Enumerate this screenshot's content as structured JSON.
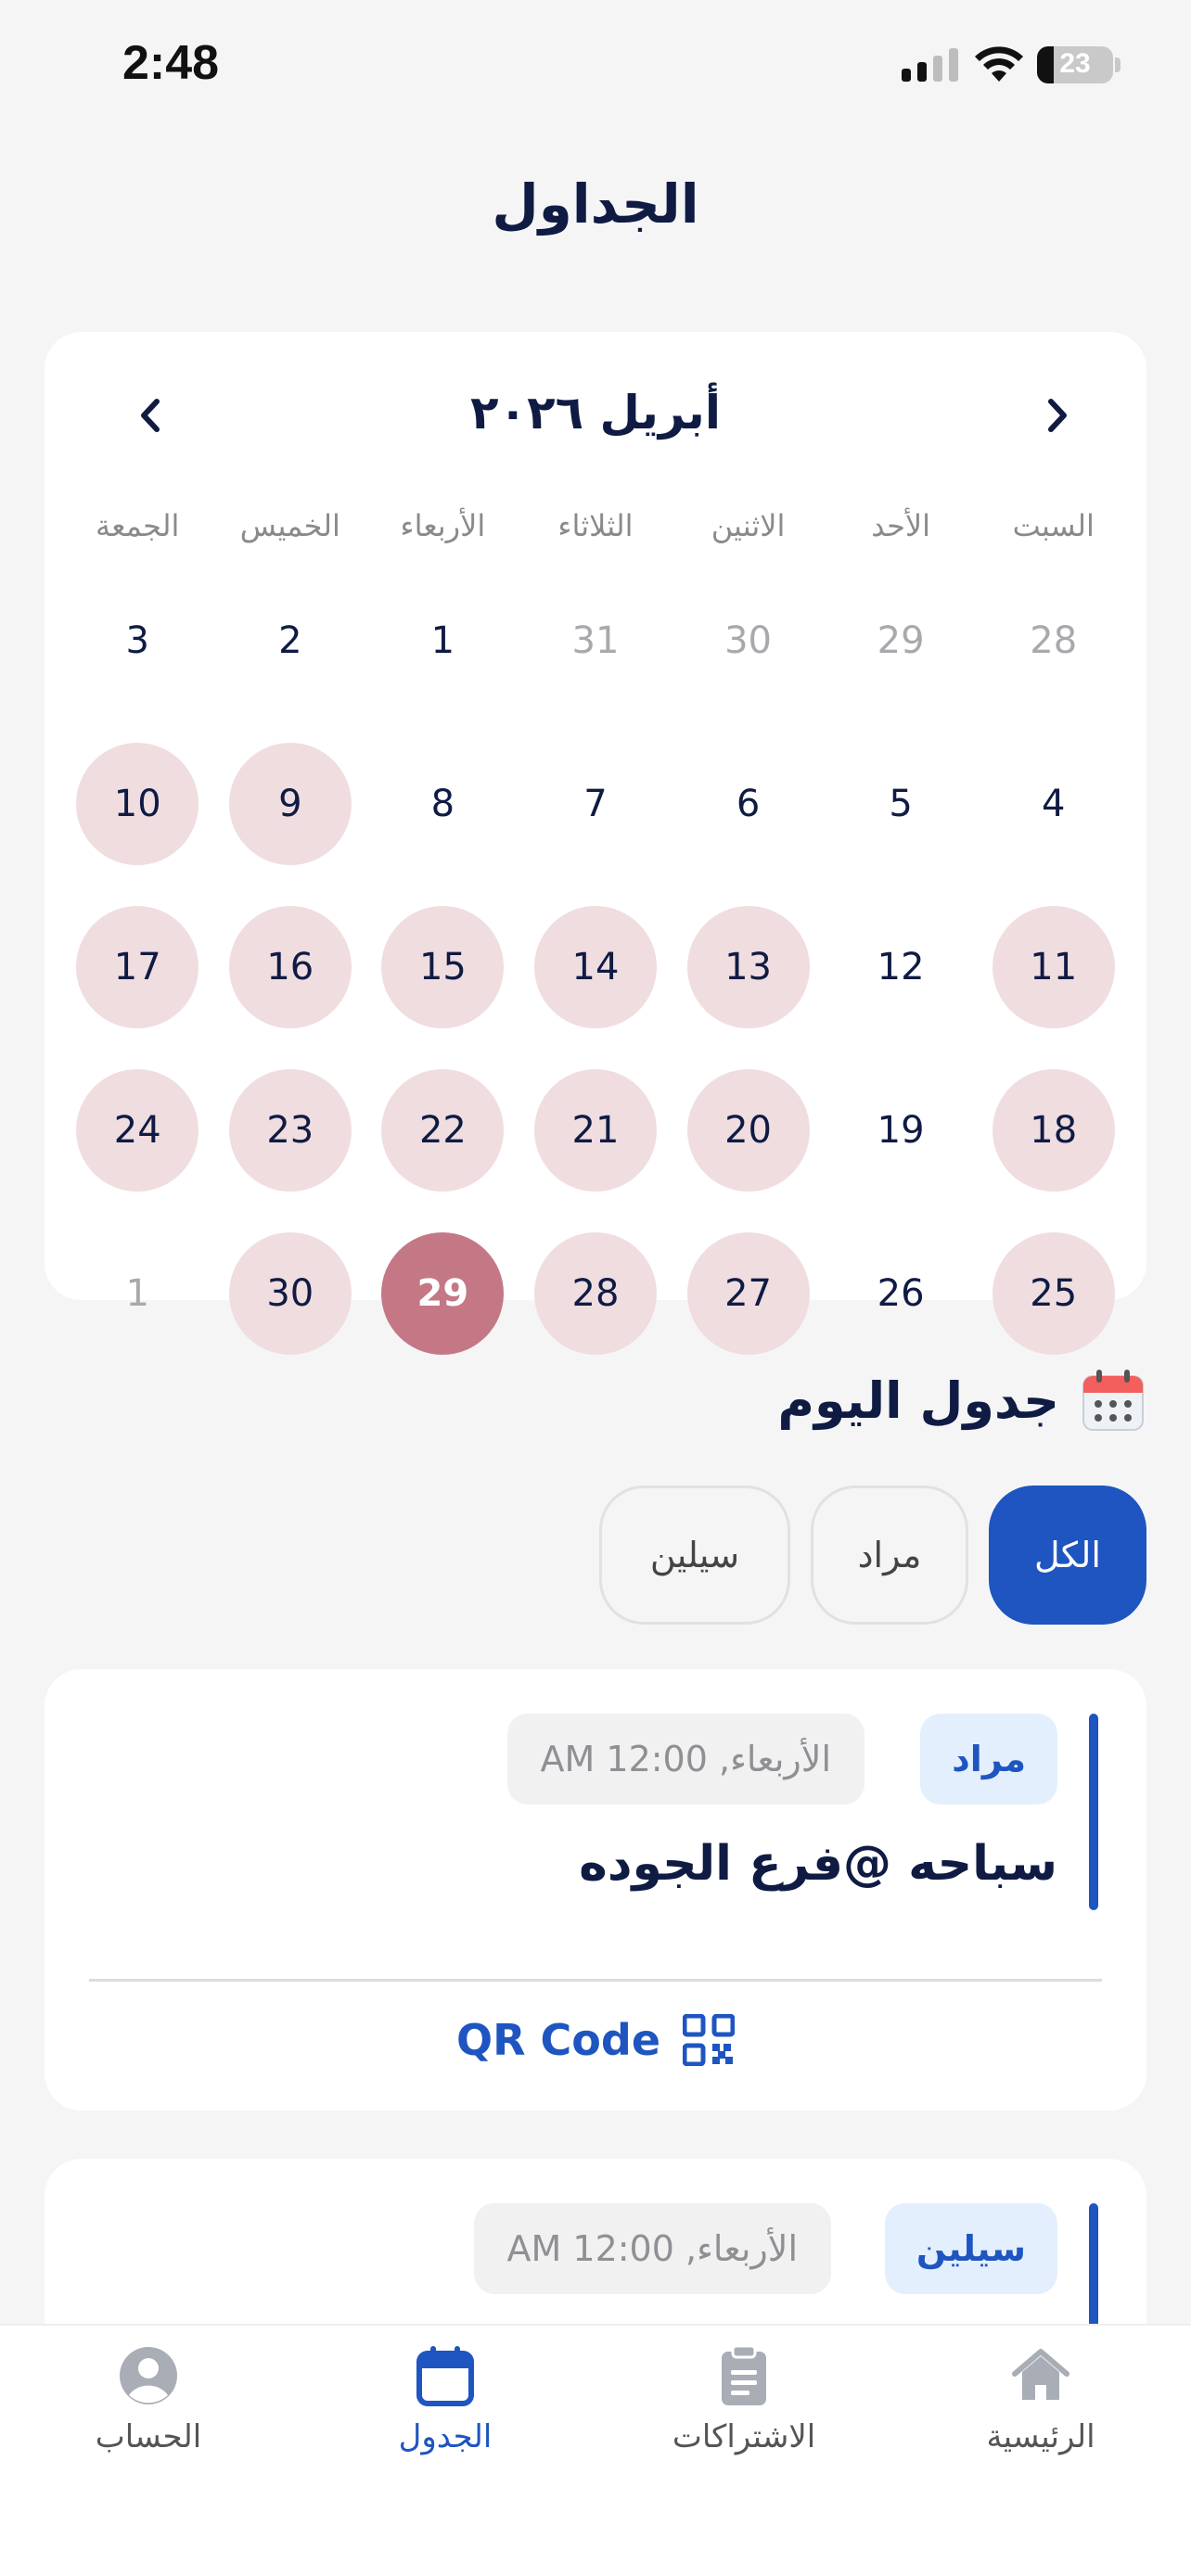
{
  "status_bar": {
    "time": "2:48",
    "battery": "23"
  },
  "header": {
    "title": "الجداول"
  },
  "calendar": {
    "month_label": "أبريل ٢٠٢٦",
    "weekdays": [
      "السبت",
      "الأحد",
      "الاثنين",
      "الثلاثاء",
      "الأربعاء",
      "الخميس",
      "الجمعة"
    ],
    "weeks": [
      [
        {
          "d": "28",
          "s": "muted"
        },
        {
          "d": "29",
          "s": "muted"
        },
        {
          "d": "30",
          "s": "muted"
        },
        {
          "d": "31",
          "s": "muted"
        },
        {
          "d": "1",
          "s": "normal"
        },
        {
          "d": "2",
          "s": "normal"
        },
        {
          "d": "3",
          "s": "normal"
        }
      ],
      [
        {
          "d": "4",
          "s": "normal"
        },
        {
          "d": "5",
          "s": "normal"
        },
        {
          "d": "6",
          "s": "normal"
        },
        {
          "d": "7",
          "s": "normal"
        },
        {
          "d": "8",
          "s": "normal"
        },
        {
          "d": "9",
          "s": "booked"
        },
        {
          "d": "10",
          "s": "booked"
        }
      ],
      [
        {
          "d": "11",
          "s": "booked"
        },
        {
          "d": "12",
          "s": "normal"
        },
        {
          "d": "13",
          "s": "booked"
        },
        {
          "d": "14",
          "s": "booked"
        },
        {
          "d": "15",
          "s": "booked"
        },
        {
          "d": "16",
          "s": "booked"
        },
        {
          "d": "17",
          "s": "booked"
        }
      ],
      [
        {
          "d": "18",
          "s": "booked"
        },
        {
          "d": "19",
          "s": "normal"
        },
        {
          "d": "20",
          "s": "booked"
        },
        {
          "d": "21",
          "s": "booked"
        },
        {
          "d": "22",
          "s": "booked"
        },
        {
          "d": "23",
          "s": "booked"
        },
        {
          "d": "24",
          "s": "booked"
        }
      ],
      [
        {
          "d": "25",
          "s": "booked"
        },
        {
          "d": "26",
          "s": "normal"
        },
        {
          "d": "27",
          "s": "booked"
        },
        {
          "d": "28",
          "s": "booked"
        },
        {
          "d": "29",
          "s": "selected"
        },
        {
          "d": "30",
          "s": "booked"
        },
        {
          "d": "1",
          "s": "muted"
        }
      ]
    ]
  },
  "today": {
    "title": "جدول اليوم"
  },
  "filters": [
    {
      "label": "الكل",
      "active": true
    },
    {
      "label": "مراد",
      "active": false
    },
    {
      "label": "سيلين",
      "active": false
    }
  ],
  "events": [
    {
      "person": "مراد",
      "time": "الأربعاء, 12:00 AM",
      "title": "سباحه @فرع الجوده",
      "qr_label": "QR Code"
    },
    {
      "person": "سيلين",
      "time": "الأربعاء, 12:00 AM"
    }
  ],
  "tab_bar": {
    "home": "الرئيسية",
    "subscriptions": "الاشتراكات",
    "schedule": "الجدول",
    "account": "الحساب"
  },
  "colors": {
    "accent": "#1e55c0",
    "booked_day": "#f0dde0",
    "selected_day": "#c47886",
    "text_dark": "#0f1b43"
  }
}
